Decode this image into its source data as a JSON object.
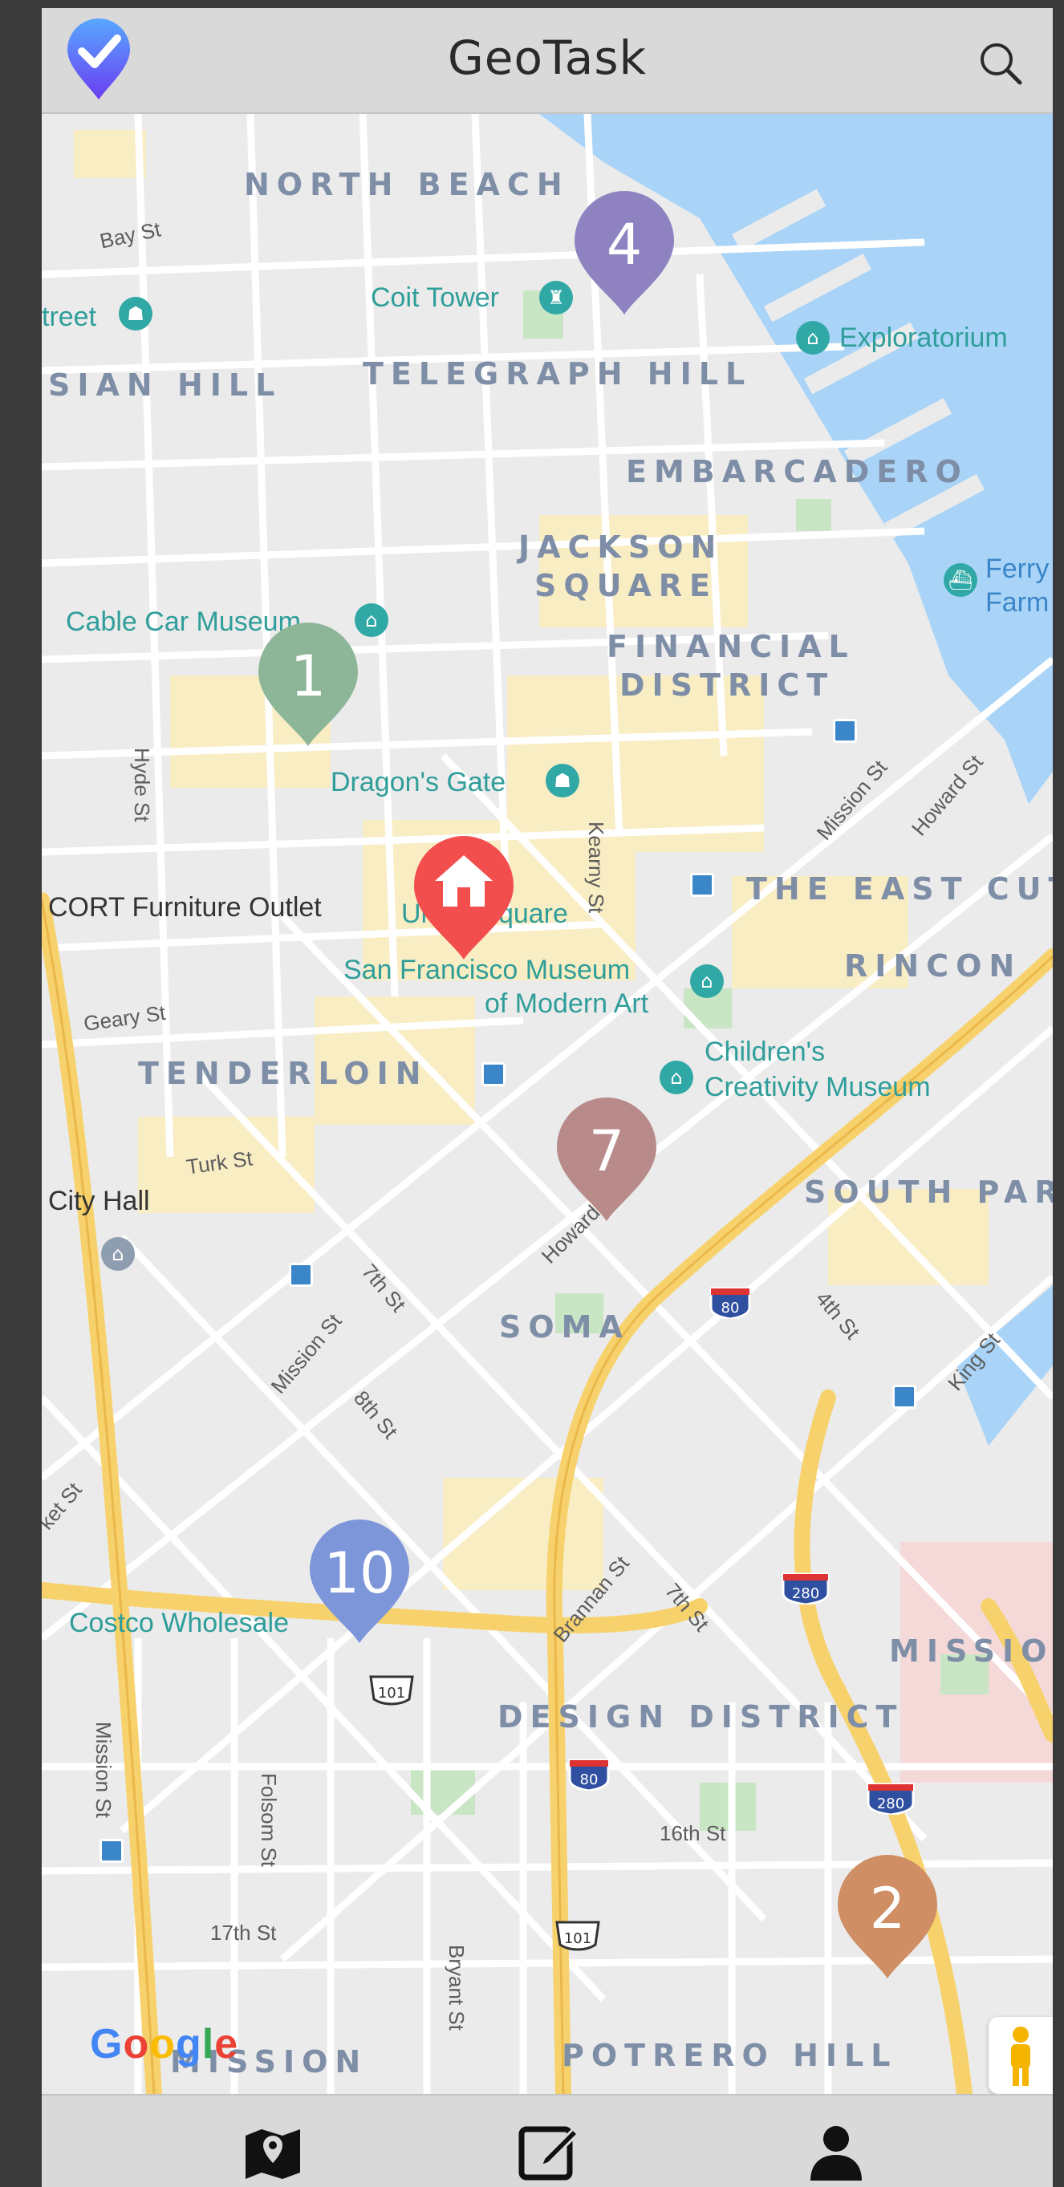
{
  "app": {
    "title": "GeoTask"
  },
  "map": {
    "districts": [
      "NORTH BEACH",
      "TELEGRAPH HILL",
      "SIAN HILL",
      "EMBARCADERO",
      "JACKSON",
      "SQUARE",
      "FINANCIAL",
      "DISTRICT",
      "THE EAST CUT",
      "RINCON",
      "TENDERLOIN",
      "SOUTH PAR",
      "SOMA",
      "MISSIO",
      "DESIGN DISTRICT",
      "MISSION",
      "POTRERO HILL"
    ],
    "places": [
      "Coit Tower",
      "Exploratorium",
      "Cable Car Museum",
      "Dragon's Gate",
      "San Francisco Museum",
      "of Modern Art",
      "Children's",
      "Creativity Museum",
      "Costco Wholesale",
      "treet",
      "Ferry",
      "Farm"
    ],
    "dark_places": [
      "CORT Furniture Outlet",
      "City Hall"
    ],
    "union_square": "Union Square",
    "streets": [
      "Bay St",
      "Hyde St",
      "Kearny St",
      "Mission St",
      "Howard St",
      "Geary St",
      "Turk St",
      "7th St",
      "Mission St",
      "8th St",
      "Howard St",
      "4th St",
      "King St",
      "Brannan St",
      "7th St",
      "Folsom St",
      "17th St",
      "Bryant St",
      "16th St",
      "Mission St",
      "ket St"
    ],
    "shields": [
      "80",
      "280",
      "101",
      "80",
      "280",
      "101"
    ],
    "google": "Google",
    "pins": [
      {
        "label": "1",
        "color": "#8db597"
      },
      {
        "label": "4",
        "color": "#8f82c1"
      },
      {
        "label": "7",
        "color": "#b88a8a"
      },
      {
        "label": "10",
        "color": "#7c96d9"
      },
      {
        "label": "2",
        "color": "#cf8e63"
      }
    ],
    "home_pin": {
      "icon": "home-icon",
      "color": "#f24e4e"
    }
  },
  "nav": [
    {
      "icon": "map-pin-icon",
      "name": "map"
    },
    {
      "icon": "edit-icon",
      "name": "tasks"
    },
    {
      "icon": "user-icon",
      "name": "profile"
    }
  ],
  "colors": {
    "bar": "#d9d9d9",
    "water": "#a9d4f7",
    "highway": "#f7d26c",
    "road": "#ffffff"
  }
}
